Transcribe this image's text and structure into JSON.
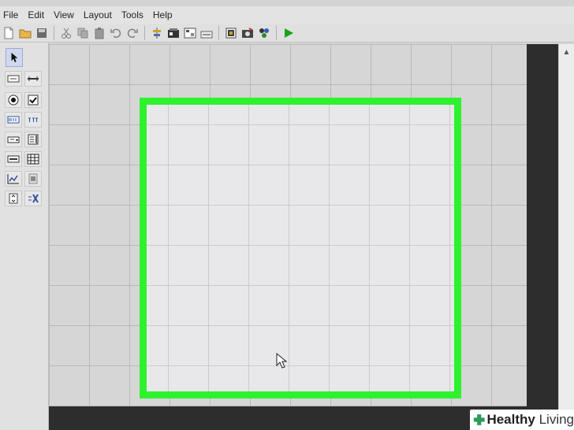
{
  "menu": [
    "File",
    "Edit",
    "View",
    "Layout",
    "Tools",
    "Help"
  ],
  "toolbar": {
    "icons": [
      "new-document-icon",
      "open-folder-icon",
      "save-icon",
      "cut-icon",
      "copy-icon",
      "paste-icon",
      "undo-icon",
      "redo-icon",
      "align-icon",
      "properties-icon",
      "layout-icon",
      "tab-order-icon",
      "form-icon",
      "image-icon",
      "colors-icon",
      "run-icon"
    ],
    "run_color": "#1aa31a"
  },
  "palette": {
    "tools": [
      "pointer-tool",
      "button-tool",
      "separator-tool",
      "radio-button-tool",
      "checkbox-tool",
      "edit-field-tool",
      "text-label-tool",
      "combo-box-tool",
      "list-box-tool",
      "slider-tool",
      "table-tool",
      "chart-tool",
      "image-tool",
      "spin-button-tool",
      "custom-control-tool"
    ]
  },
  "colors": {
    "highlight": "#2ef22e",
    "dark_panel": "#2d2d2d"
  },
  "watermark": {
    "brand_bold": "Healthy",
    "brand_regular": " Living"
  }
}
